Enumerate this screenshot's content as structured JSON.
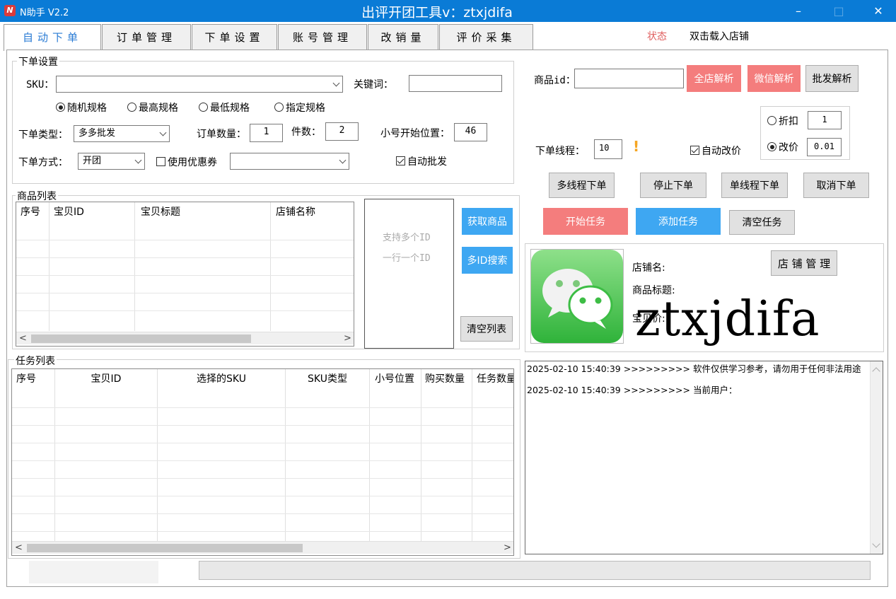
{
  "window": {
    "app_name": "N助手 V2.2",
    "title": "出评开团工具v：ztxjdifa",
    "app_icon_glyph": "N",
    "minimize": "–",
    "maximize": "□",
    "close": "✕"
  },
  "tabs": [
    {
      "label": "自动下单",
      "active": true
    },
    {
      "label": "订单管理"
    },
    {
      "label": "下单设置"
    },
    {
      "label": "账号管理"
    },
    {
      "label": "改销量"
    },
    {
      "label": "评价采集"
    }
  ],
  "status": {
    "label": "状态",
    "value": "双击载入店铺"
  },
  "order_settings": {
    "legend": "下单设置",
    "sku_label": "SKU：",
    "sku_value": "",
    "keyword_label": "关键词：",
    "keyword_value": "",
    "spec_options": [
      {
        "label": "随机规格",
        "checked": true
      },
      {
        "label": "最高规格",
        "checked": false
      },
      {
        "label": "最低规格",
        "checked": false
      },
      {
        "label": "指定规格",
        "checked": false
      }
    ],
    "order_type_label": "下单类型：",
    "order_type_value": "多多批发",
    "order_qty_label": "订单数量：",
    "order_qty_value": "1",
    "pieces_label": "件数：",
    "pieces_value": "2",
    "start_pos_label": "小号开始位置：",
    "start_pos_value": "46",
    "order_method_label": "下单方式：",
    "order_method_value": "开团",
    "use_coupon_label": "使用优惠券",
    "use_coupon_checked": false,
    "coupon_value": "",
    "auto_batch_label": "自动批发",
    "auto_batch_checked": true
  },
  "product_list": {
    "legend": "商品列表",
    "columns": [
      "序号",
      "宝贝ID",
      "宝贝标题",
      "店铺名称"
    ],
    "rows": [],
    "id_hint_1": "支持多个ID",
    "id_hint_2": "一行一个ID",
    "btn_get": "获取商品",
    "btn_multi_search": "多ID搜索",
    "btn_clear": "清空列表",
    "scroll_left": "<",
    "scroll_right": ">"
  },
  "task_list": {
    "legend": "任务列表",
    "columns": [
      "序号",
      "宝贝ID",
      "选择的SKU",
      "SKU类型",
      "小号位置",
      "购买数量",
      "任务数量"
    ],
    "rows": [],
    "scroll_left": "<",
    "scroll_right": ">"
  },
  "right_panel": {
    "product_id_label": "商品id：",
    "product_id_value": "",
    "btn_full_store": "全店解析",
    "btn_wechat": "微信解析",
    "btn_batch": "批发解析",
    "discount_label": "折扣",
    "discount_checked": false,
    "discount_value": "1",
    "change_price_label": "改价",
    "change_price_checked": true,
    "change_price_value": "0.01",
    "thread_label": "下单线程：",
    "thread_value": "10",
    "warn_glyph": "!",
    "auto_change_price_label": "自动改价",
    "auto_change_price_checked": true,
    "btn_multi_thread": "多线程下单",
    "btn_stop": "停止下单",
    "btn_single_thread": "单线程下单",
    "btn_cancel": "取消下单",
    "btn_start_task": "开始任务",
    "btn_add_task": "添加任务",
    "btn_clear_task": "清空任务"
  },
  "shop_info": {
    "store_name_label": "店铺名:",
    "product_title_label": "商品标题:",
    "price_label": "宝贝价:",
    "btn_store_manage": "店 铺 管 理",
    "watermark": "ztxjdifa"
  },
  "log": {
    "lines": [
      "2025-02-10 15:40:39 >>>>>>>>> 软件仅供学习参考，请勿用于任何非法用途",
      "2025-02-10 15:40:39 >>>>>>>>> 当前用户："
    ]
  },
  "progress": {
    "value": 0
  },
  "colors": {
    "titlebar": "#0a7bd6",
    "active_tab_text": "#2a7bd4",
    "red_button": "#f47d7d",
    "blue_button": "#3ea7f2",
    "status_label": "#e06060",
    "warning": "#f5a623",
    "wechat_green": "#3dbd45"
  }
}
